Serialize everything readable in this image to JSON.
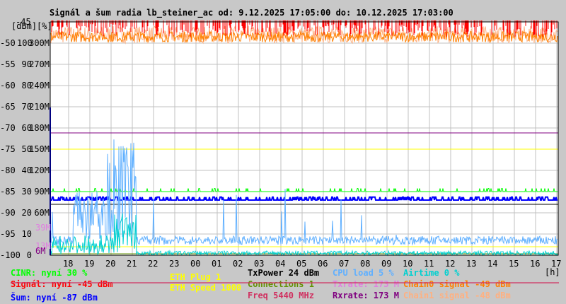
{
  "chart_data": {
    "type": "line",
    "title": "Signál a šum radia lb_steiner_ac od: 9.12.2025 17:05:00 do: 10.12.2025 17:03:00",
    "y_axes": {
      "dbm": {
        "label": "[dBm]",
        "ticks": [
          "-45",
          "-50",
          "-55",
          "-60",
          "-65",
          "-70",
          "-75",
          "-80",
          "-85",
          "-90",
          "-95",
          "-100"
        ],
        "range": [
          -100,
          -45
        ]
      },
      "percent": {
        "label": "[%]",
        "ticks": [
          "100",
          "90",
          "80",
          "70",
          "60",
          "50",
          "40",
          "30",
          "20",
          "10",
          "0"
        ],
        "range": [
          0,
          110
        ]
      },
      "rate": {
        "ticks": [
          "300M",
          "270M",
          "240M",
          "210M",
          "180M",
          "150M",
          "120M",
          "90M",
          "60M"
        ],
        "range": [
          0,
          330
        ]
      }
    },
    "inline_labels": [
      {
        "text": "39M",
        "color": "#e080e0",
        "value_m": 39
      },
      {
        "text": "13M",
        "color": "#e080e0",
        "value_m": 13
      },
      {
        "text": "6M",
        "color": "#800080",
        "value_m": 6
      }
    ],
    "x_ticks": [
      "18",
      "19",
      "20",
      "21",
      "22",
      "23",
      "00",
      "01",
      "02",
      "03",
      "04",
      "05",
      "06",
      "07",
      "08",
      "09",
      "10",
      "11",
      "12",
      "13",
      "14",
      "15",
      "16",
      "17"
    ],
    "x_unit": "[h]",
    "x_range_hours": [
      17.08,
      41.05
    ],
    "grid": true,
    "series": [
      {
        "name": "Signál",
        "unit": "dBm",
        "color": "#ff0000",
        "typical": -45.5,
        "min": -48
      },
      {
        "name": "Chain0 signal",
        "unit": "dBm",
        "color": "#ff8000",
        "typical": -49,
        "min": -51
      },
      {
        "name": "Chain1 signal",
        "unit": "dBm",
        "color": "#ffb080",
        "typical": -48,
        "min": -50
      },
      {
        "name": "Šum",
        "unit": "dBm",
        "color": "#0000ff",
        "typical": -87,
        "min": -87.5,
        "max": -86
      },
      {
        "name": "CINR",
        "unit": "%",
        "color": "#00ff00",
        "typical": 30,
        "max": 31
      },
      {
        "name": "CPU load",
        "unit": "%",
        "color": "#60b0ff",
        "typical": 5,
        "peak": 62,
        "peak_hours": [
          19,
          21
        ]
      },
      {
        "name": "Airtime",
        "unit": "%",
        "color": "#00d0d0",
        "typical": 1,
        "peak": 20
      },
      {
        "name": "TxPower",
        "unit": "dBm",
        "color": "#000000",
        "value": 24
      },
      {
        "name": "Rxrate",
        "unit": "M",
        "color": "#800080",
        "value": 173
      },
      {
        "name": "Txrate",
        "unit": "M",
        "color": "#e080e0",
        "value": 173
      },
      {
        "name": "ETH Speed",
        "color": "#ffff00",
        "value": 1000
      },
      {
        "name": "ETH Plug",
        "color": "#ffff00",
        "value": 1
      },
      {
        "name": "Connections",
        "color": "#609000",
        "value": 1
      }
    ]
  },
  "legend": {
    "cinr": "CINR: nyní 30 %",
    "signal": "Signál: nyní -45 dBm",
    "noise": "Šum: nyní -87 dBm",
    "eth_plug": "ETH Plug 1",
    "eth_speed": "ETH Speed 1000",
    "txpower": "TxPower 24 dBm",
    "connections": "Connections 1",
    "freq": "Freq 5440 MHz",
    "cpu": "CPU load 5 %",
    "txrate": "Txrate: 173 M",
    "rxrate": "Rxrate: 173 M",
    "airtime": "Airtime 0 %",
    "chain0": "Chain0 signal -49 dBm",
    "chain1": "Chain1 signal -48 dBm"
  },
  "colors": {
    "freq": "#d03060",
    "connections": "#609000"
  }
}
